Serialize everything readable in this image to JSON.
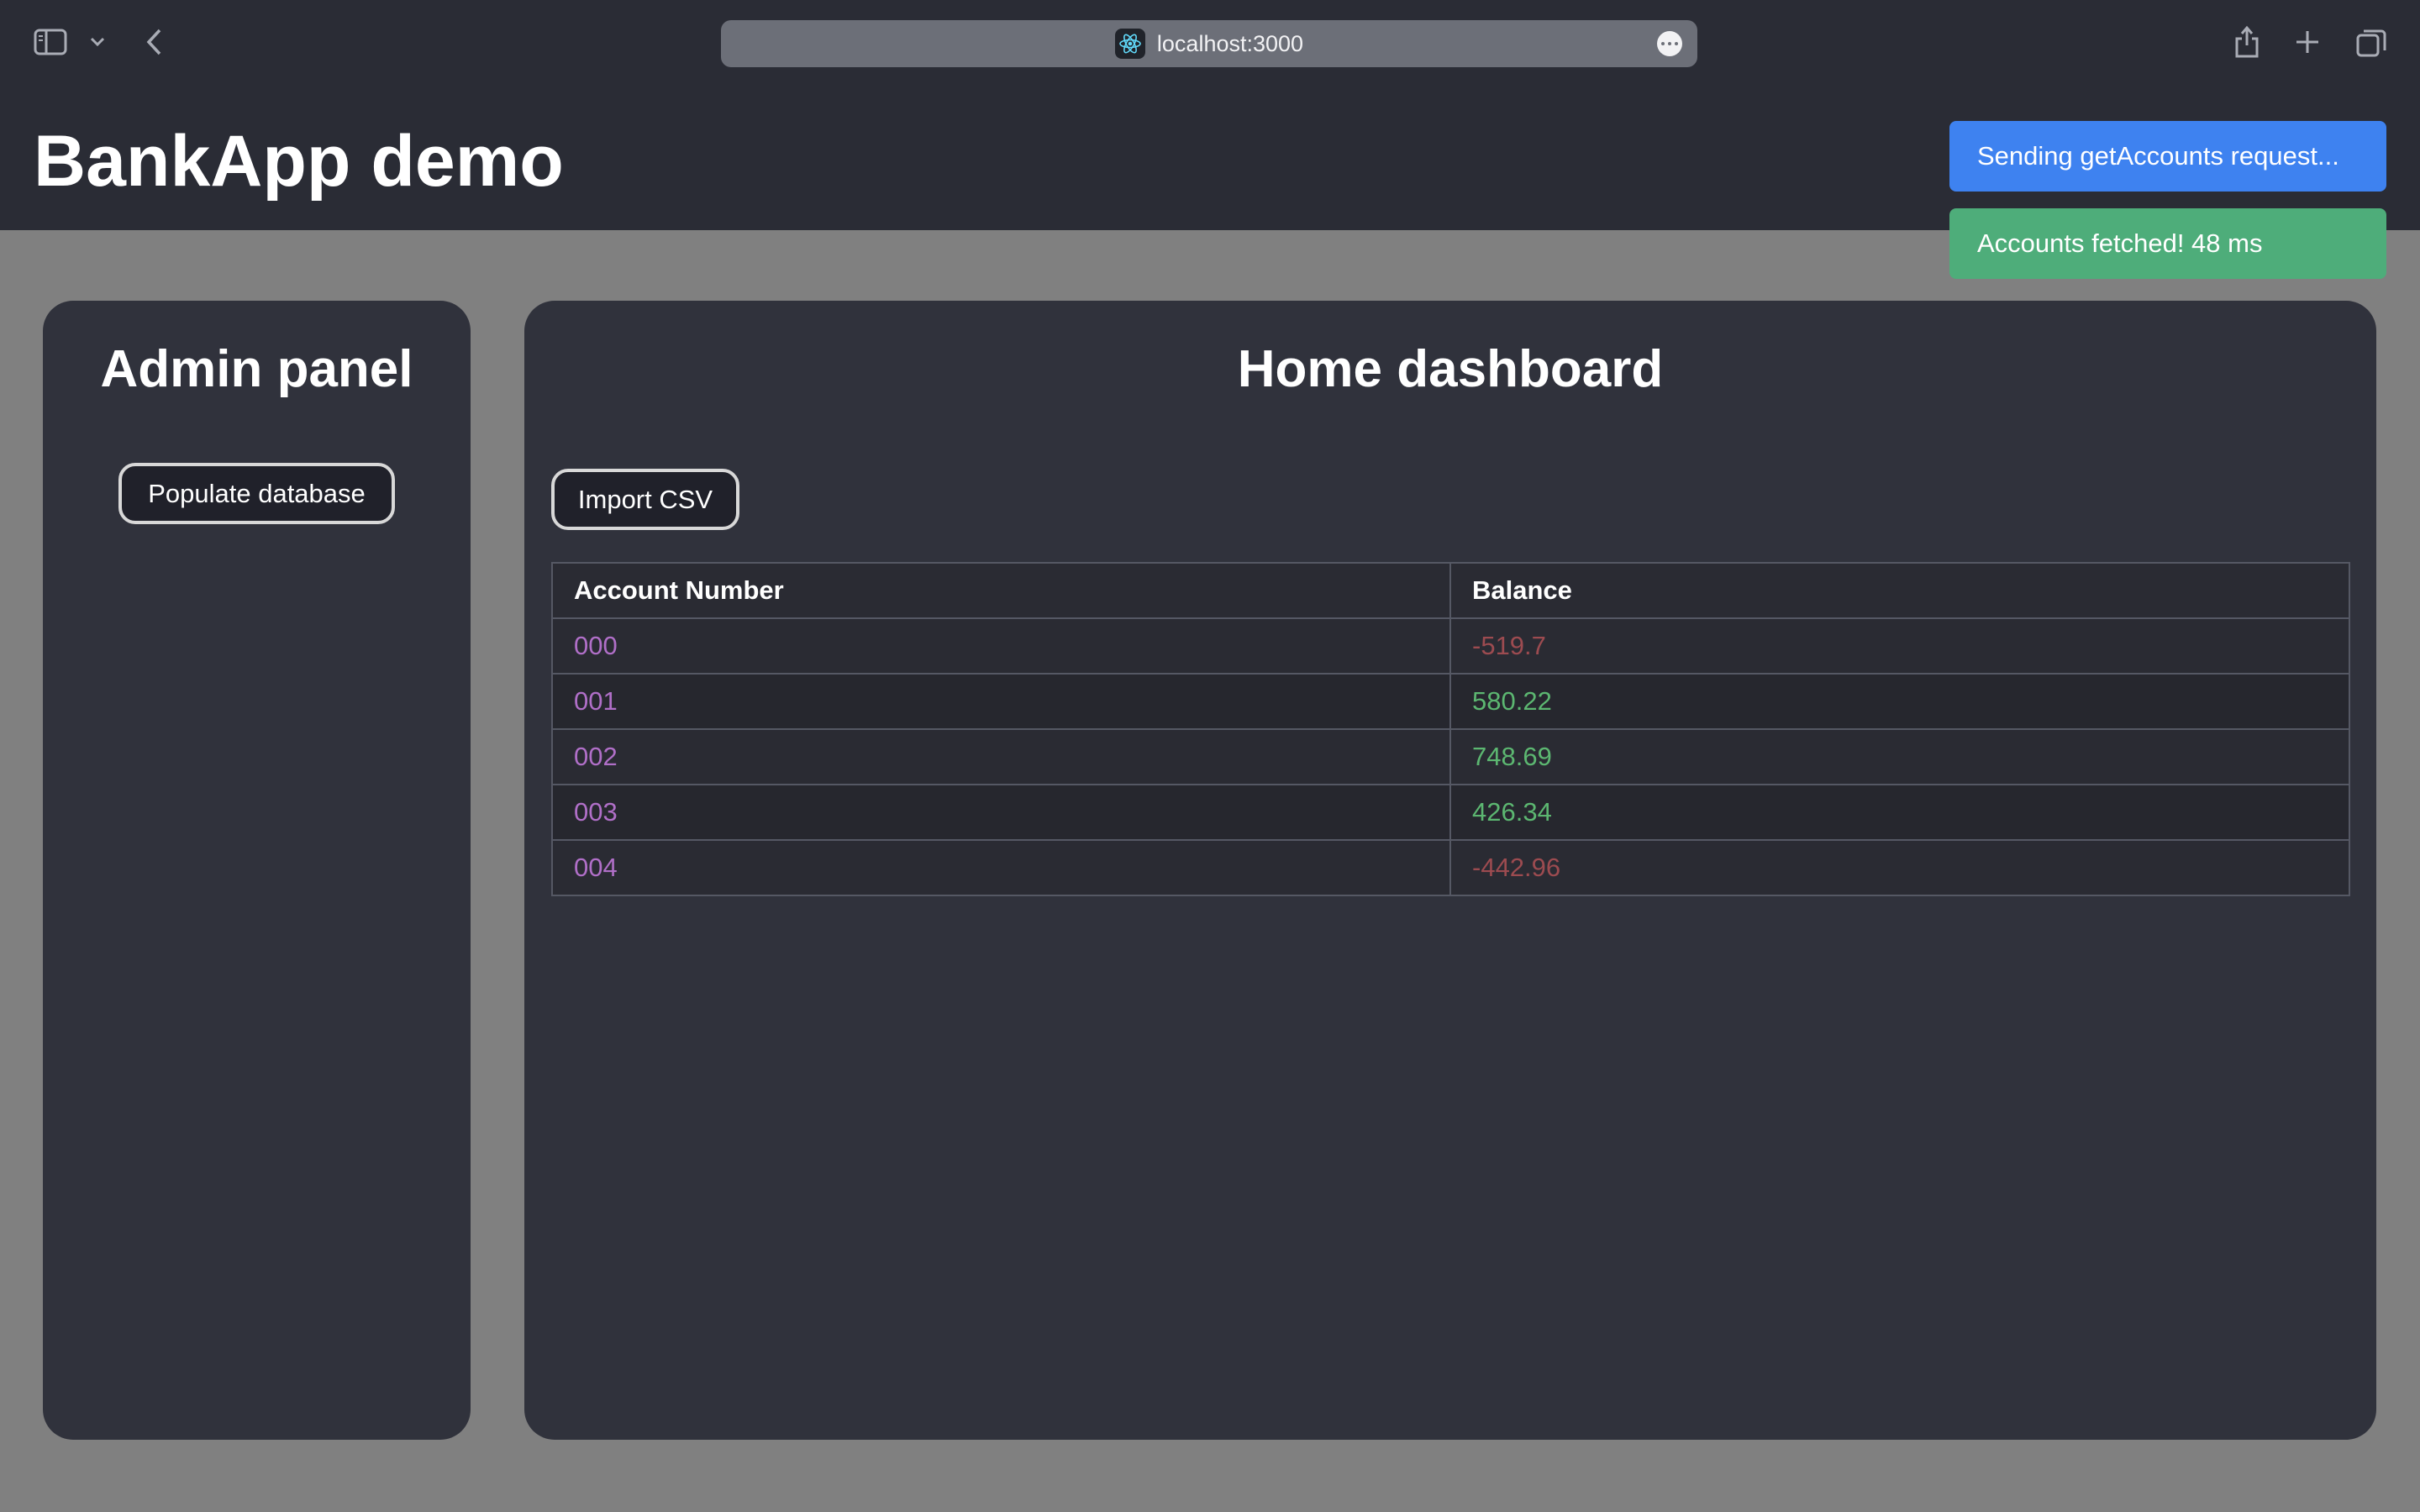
{
  "browser": {
    "url": "localhost:3000"
  },
  "app": {
    "title": "BankApp demo"
  },
  "toasts": [
    {
      "text": "Sending getAccounts request...",
      "kind": "info",
      "color": "#3e82f0"
    },
    {
      "text": "Accounts fetched! 48 ms",
      "kind": "success",
      "color": "#4ead7a"
    }
  ],
  "admin_panel": {
    "title": "Admin panel",
    "populate_label": "Populate database"
  },
  "dashboard": {
    "title": "Home dashboard",
    "import_label": "Import CSV",
    "table": {
      "headers": [
        "Account Number",
        "Balance"
      ],
      "rows": [
        {
          "account": "000",
          "balance": "-519.7",
          "sign": "negative"
        },
        {
          "account": "001",
          "balance": "580.22",
          "sign": "positive"
        },
        {
          "account": "002",
          "balance": "748.69",
          "sign": "positive"
        },
        {
          "account": "003",
          "balance": "426.34",
          "sign": "positive"
        },
        {
          "account": "004",
          "balance": "-442.96",
          "sign": "negative"
        }
      ]
    }
  },
  "colors": {
    "positive": "#5cb771",
    "negative": "#9c4b50",
    "account": "#b06fc8"
  }
}
